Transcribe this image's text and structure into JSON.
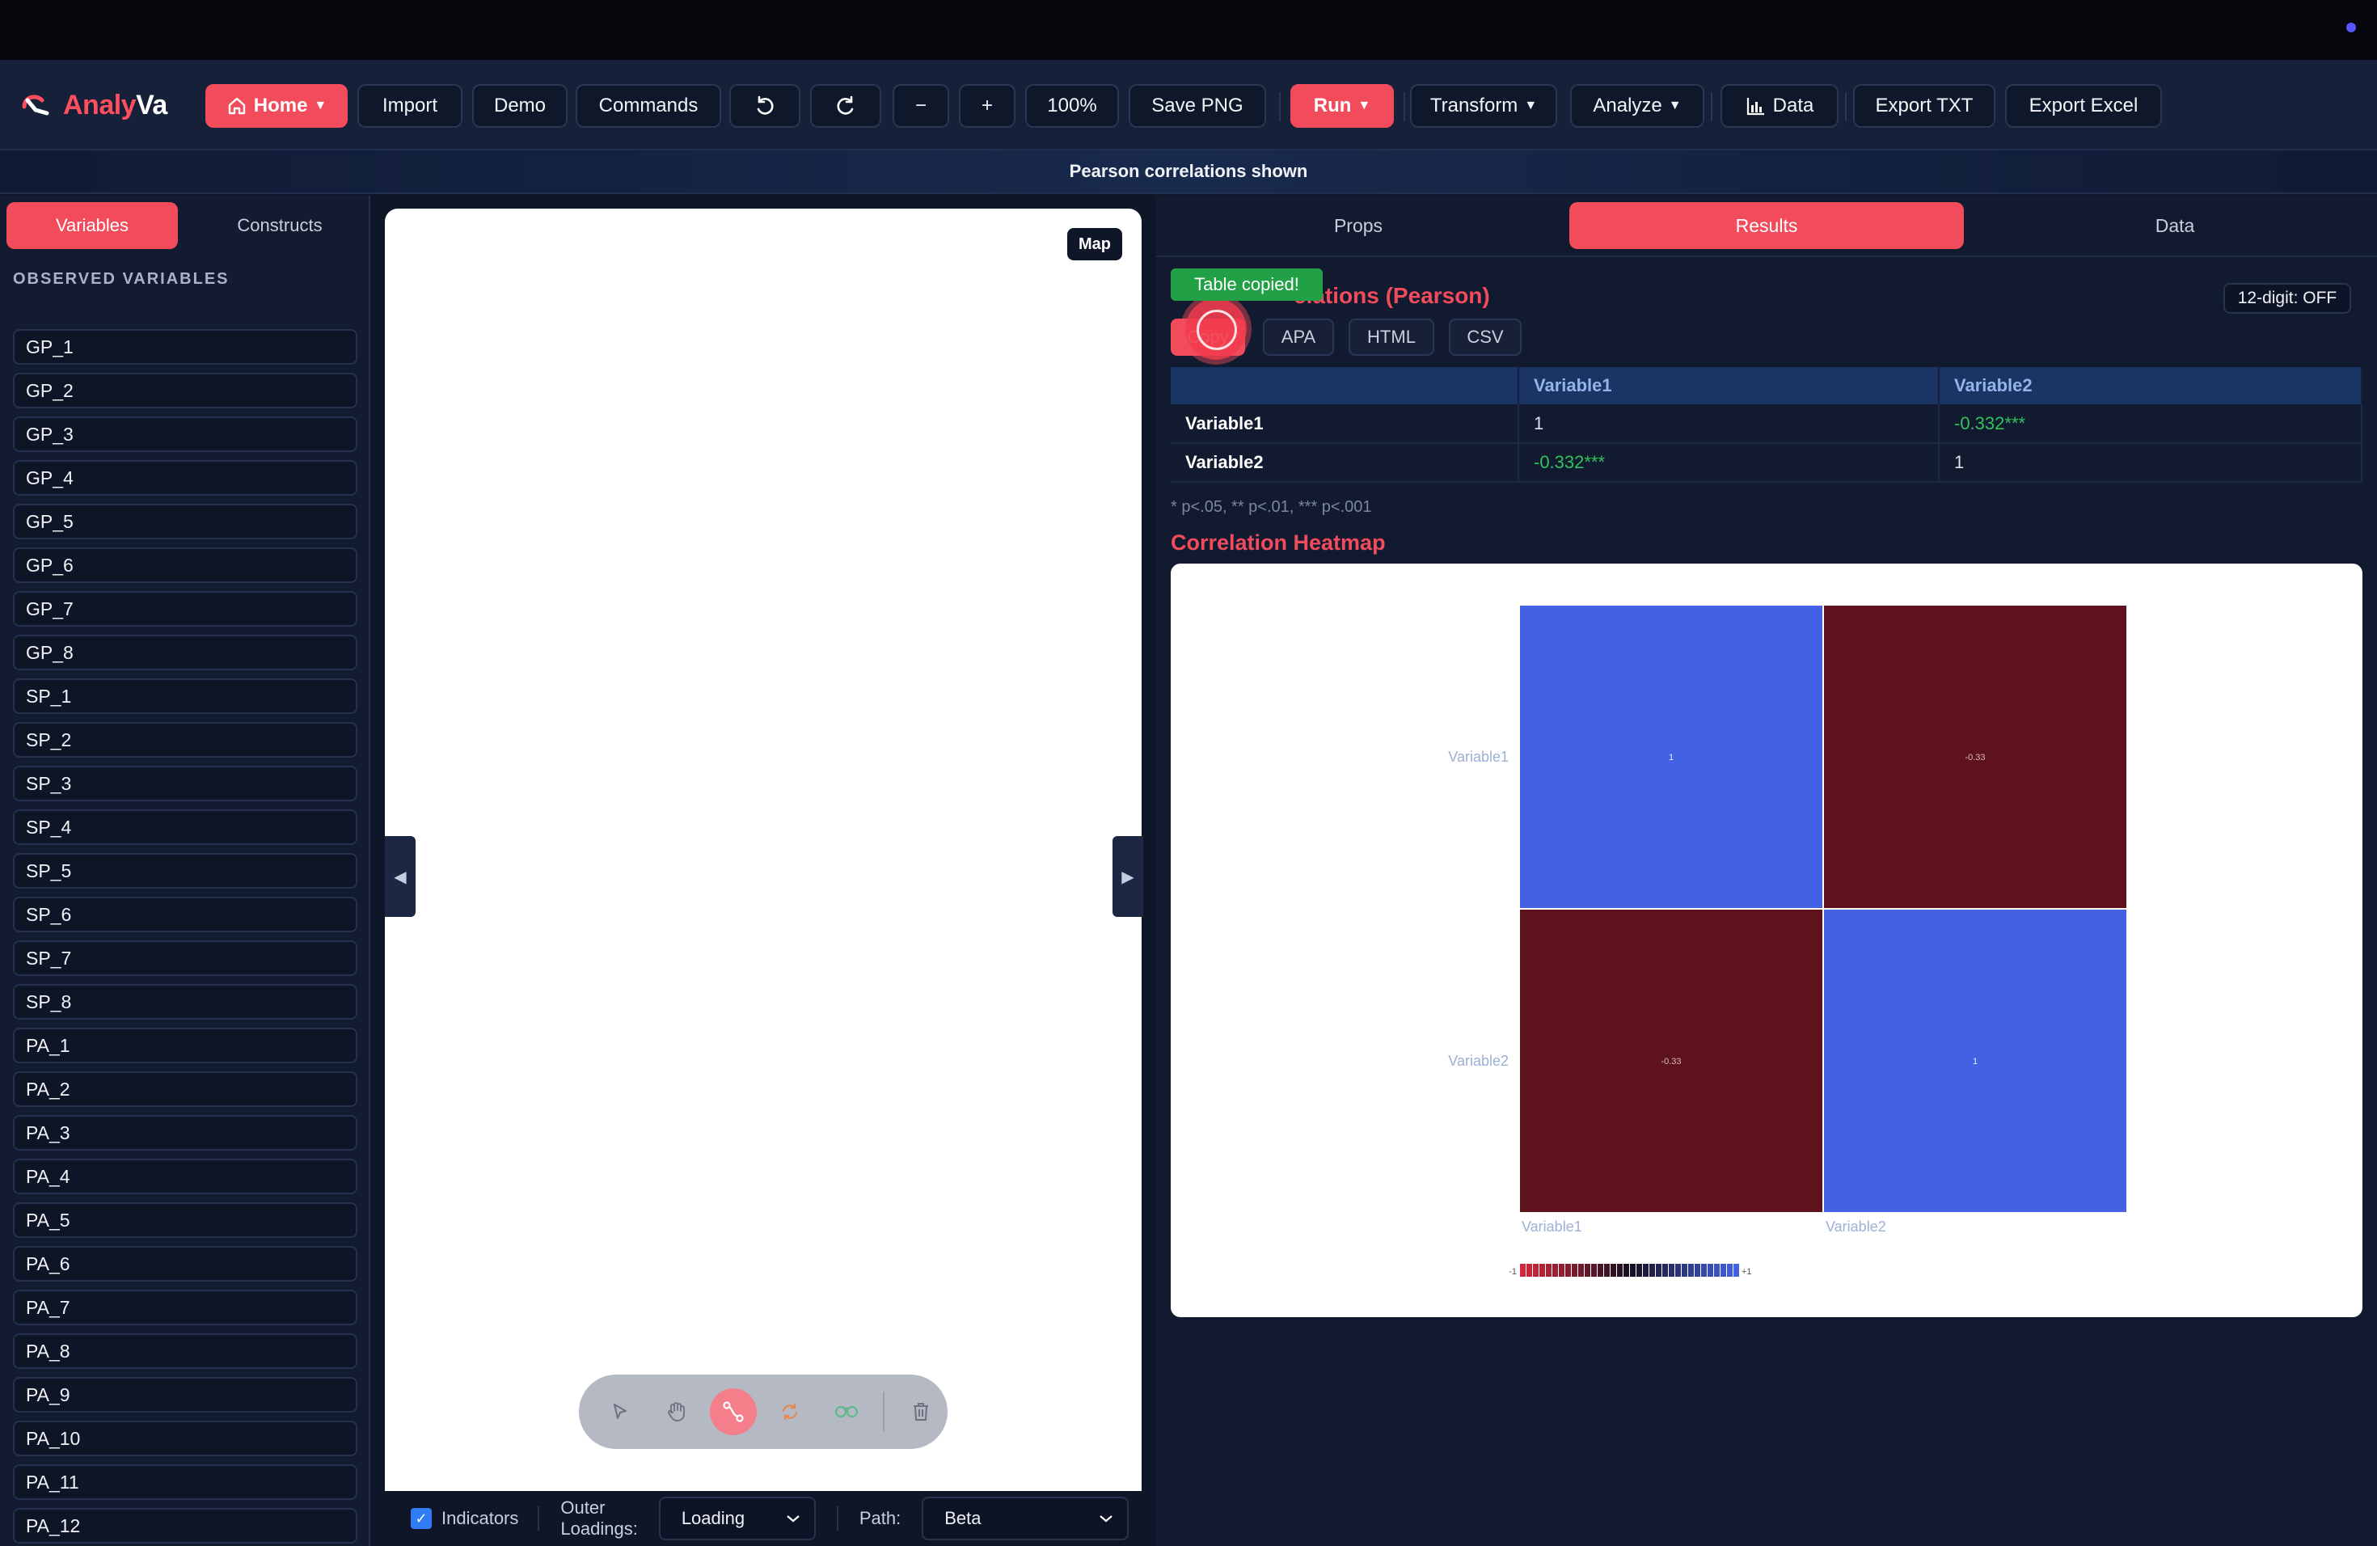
{
  "app": {
    "name_part1": "Analy",
    "name_part2": "Va"
  },
  "toolbar": {
    "home": "Home",
    "import": "Import",
    "demo": "Demo",
    "commands": "Commands",
    "zoom_out": "−",
    "zoom_in": "+",
    "zoom_level": "100%",
    "save_png": "Save PNG",
    "run": "Run",
    "transform": "Transform",
    "analyze": "Analyze",
    "data": "Data",
    "export_txt": "Export TXT",
    "export_excel": "Export Excel"
  },
  "banner": "Pearson correlations shown",
  "left_panel": {
    "tabs": [
      "Variables",
      "Constructs"
    ],
    "active_tab": "Variables",
    "heading": "OBSERVED VARIABLES",
    "variables": [
      "GP_1",
      "GP_2",
      "GP_3",
      "GP_4",
      "GP_5",
      "GP_6",
      "GP_7",
      "GP_8",
      "SP_1",
      "SP_2",
      "SP_3",
      "SP_4",
      "SP_5",
      "SP_6",
      "SP_7",
      "SP_8",
      "PA_1",
      "PA_2",
      "PA_3",
      "PA_4",
      "PA_5",
      "PA_6",
      "PA_7",
      "PA_8",
      "PA_9",
      "PA_10",
      "PA_11",
      "PA_12"
    ]
  },
  "canvas": {
    "map_button": "Map",
    "tools": [
      "pointer-icon",
      "hand-icon",
      "connect-icon",
      "cycle-icon",
      "link-icon",
      "trash-icon"
    ],
    "active_tool": "connect-icon",
    "footer": {
      "indicators_label": "Indicators",
      "indicators_checked": true,
      "outer_loadings_label_1": "Outer",
      "outer_loadings_label_2": "Loadings:",
      "outer_loadings_value": "Loading",
      "path_label": "Path:",
      "path_value": "Beta"
    }
  },
  "right_panel": {
    "tabs": [
      "Props",
      "Results",
      "Data"
    ],
    "active_tab": "Results",
    "toast": "Table copied!",
    "section_title": "elations (Pearson)",
    "digit_toggle": "12-digit: OFF",
    "format_buttons": [
      "Copy",
      "APA",
      "HTML",
      "CSV"
    ],
    "table": {
      "headers": [
        "",
        "Variable1",
        "Variable2"
      ],
      "rows": [
        {
          "name": "Variable1",
          "cells": [
            "1",
            "-0.332***"
          ]
        },
        {
          "name": "Variable2",
          "cells": [
            "-0.332***",
            "1"
          ]
        }
      ]
    },
    "note": "* p<.05, ** p<.01, *** p<.001",
    "heatmap_title": "Correlation Heatmap"
  },
  "chart_data": {
    "type": "heatmap",
    "title": "Correlation Heatmap",
    "x_labels": [
      "Variable1",
      "Variable2"
    ],
    "y_labels": [
      "Variable1",
      "Variable2"
    ],
    "values": [
      [
        1,
        -0.33
      ],
      [
        -0.33,
        1
      ]
    ],
    "cell_labels": [
      [
        "1",
        "-0.33"
      ],
      [
        "-0.33",
        "1"
      ]
    ],
    "color_positive": "#4561e3",
    "color_negative": "#5e121b",
    "legend_min_label": "-1",
    "legend_max_label": "+1",
    "legend_steps": 34
  },
  "colors": {
    "accent": "#f24b5c",
    "success": "#22a046",
    "background": "#0f1628"
  }
}
